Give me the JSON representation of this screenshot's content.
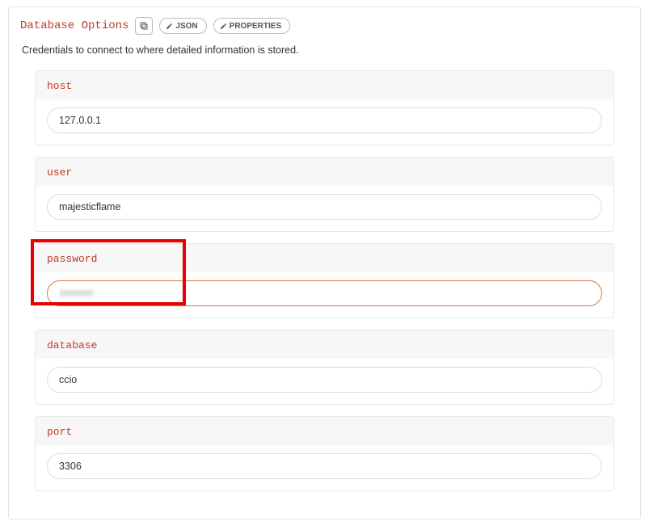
{
  "section": {
    "title": "Database Options",
    "description": "Credentials to connect to where detailed information is stored."
  },
  "buttons": {
    "json": "JSON",
    "properties": "PROPERTIES"
  },
  "fields": {
    "host": {
      "label": "host",
      "value": "127.0.0.1"
    },
    "user": {
      "label": "user",
      "value": "majesticflame"
    },
    "password": {
      "label": "password",
      "value": "••••••••"
    },
    "database": {
      "label": "database",
      "value": "ccio"
    },
    "port": {
      "label": "port",
      "value": "3306"
    }
  }
}
